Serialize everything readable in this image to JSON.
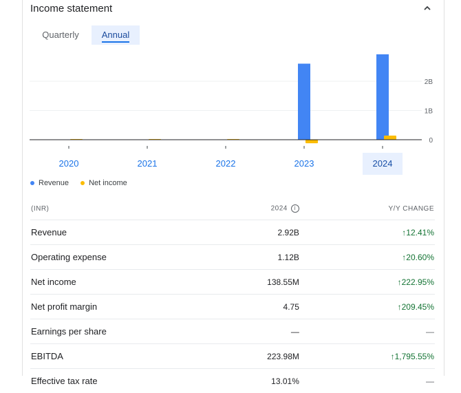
{
  "header": {
    "title": "Income statement",
    "collapse_icon": "chevron-up-icon"
  },
  "tabs": [
    {
      "label": "Quarterly",
      "selected": false
    },
    {
      "label": "Annual",
      "selected": true
    }
  ],
  "chart_data": {
    "type": "bar",
    "categories": [
      "2020",
      "2021",
      "2022",
      "2023",
      "2024"
    ],
    "series": [
      {
        "name": "Revenue",
        "color": "#4285f4",
        "values": [
          0,
          0,
          0,
          2.6,
          2.92
        ]
      },
      {
        "name": "Net income",
        "color": "#fbbc04",
        "values": [
          0,
          0,
          0,
          -0.12,
          0.14
        ]
      }
    ],
    "y_unit": "B",
    "y_ticks": [
      "0",
      "1B",
      "2B"
    ],
    "y_tick_values": [
      0,
      1,
      2
    ],
    "ylim": [
      -0.15,
      3.2
    ],
    "selected_category": "2024",
    "legend_position": "bottom-left",
    "grid": true
  },
  "table": {
    "headers": {
      "label": "(INR)",
      "period": "2024",
      "change": "Y/Y CHANGE"
    },
    "rows": [
      {
        "label": "Revenue",
        "value": "2.92B",
        "change": "↑12.41%",
        "trend": "up"
      },
      {
        "label": "Operating expense",
        "value": "1.12B",
        "change": "↑20.60%",
        "trend": "up"
      },
      {
        "label": "Net income",
        "value": "138.55M",
        "change": "↑222.95%",
        "trend": "up"
      },
      {
        "label": "Net profit margin",
        "value": "4.75",
        "change": "↑209.45%",
        "trend": "up"
      },
      {
        "label": "Earnings per share",
        "value": "—",
        "change": "—",
        "trend": "none"
      },
      {
        "label": "EBITDA",
        "value": "223.98M",
        "change": "↑1,795.55%",
        "trend": "up"
      },
      {
        "label": "Effective tax rate",
        "value": "13.01%",
        "change": "—",
        "trend": "none"
      }
    ]
  }
}
